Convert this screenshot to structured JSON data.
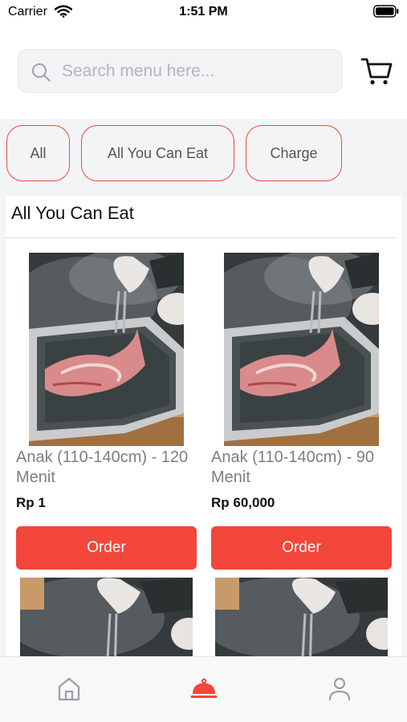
{
  "status_bar": {
    "carrier": "Carrier",
    "time": "1:51 PM"
  },
  "search": {
    "placeholder": "Search menu here..."
  },
  "filters": [
    {
      "label": "All"
    },
    {
      "label": "All You Can Eat"
    },
    {
      "label": "Charge"
    }
  ],
  "section": {
    "title": "All You Can Eat"
  },
  "products": [
    {
      "name": "Anak (110-140cm) - 120 Menit",
      "price": "Rp 1",
      "order_label": "Order"
    },
    {
      "name": "Anak (110-140cm) - 90 Menit",
      "price": "Rp 60,000",
      "order_label": "Order"
    }
  ],
  "tabs": [
    {
      "icon": "home-icon"
    },
    {
      "icon": "cloche-icon",
      "active": true
    },
    {
      "icon": "user-icon"
    }
  ],
  "colors": {
    "accent": "#f2473a",
    "chip_border": "#e8493c",
    "inactive_icon": "#9a9ea4",
    "background": "#f3f4f6"
  }
}
